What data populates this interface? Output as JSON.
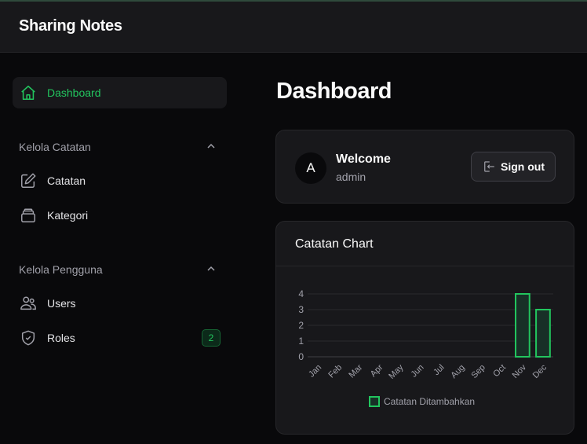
{
  "app": {
    "title": "Sharing Notes"
  },
  "sidebar": {
    "dashboard": {
      "label": "Dashboard",
      "icon": "home-icon"
    },
    "groups": [
      {
        "title": "Kelola Catatan",
        "icon": "chevron-up-icon",
        "items": [
          {
            "label": "Catatan",
            "icon": "edit-icon"
          },
          {
            "label": "Kategori",
            "icon": "archive-icon"
          }
        ]
      },
      {
        "title": "Kelola Pengguna",
        "icon": "chevron-up-icon",
        "items": [
          {
            "label": "Users",
            "icon": "users-icon"
          },
          {
            "label": "Roles",
            "icon": "shield-check-icon",
            "badge": "2"
          }
        ]
      }
    ]
  },
  "main": {
    "title": "Dashboard",
    "welcome": {
      "avatar": "A",
      "title": "Welcome",
      "subtitle": "admin",
      "signout_label": "Sign out"
    },
    "chart_card": {
      "title": "Catatan Chart"
    }
  },
  "colors": {
    "accent": "#22c55e",
    "bar_fill": "#183027",
    "background": "#09090b",
    "card": "#18181b"
  },
  "chart_data": {
    "type": "bar",
    "title": "Catatan Chart",
    "categories": [
      "Jan",
      "Feb",
      "Mar",
      "Apr",
      "May",
      "Jun",
      "Jul",
      "Aug",
      "Sep",
      "Oct",
      "Nov",
      "Dec"
    ],
    "series": [
      {
        "name": "Catatan Ditambahkan",
        "values": [
          0,
          0,
          0,
          0,
          0,
          0,
          0,
          0,
          0,
          0,
          4,
          3
        ]
      }
    ],
    "yticks": [
      0,
      1,
      2,
      3,
      4
    ],
    "ylim": [
      0,
      4
    ],
    "xlabel": "",
    "ylabel": "",
    "grid": true,
    "legend": "bottom"
  }
}
